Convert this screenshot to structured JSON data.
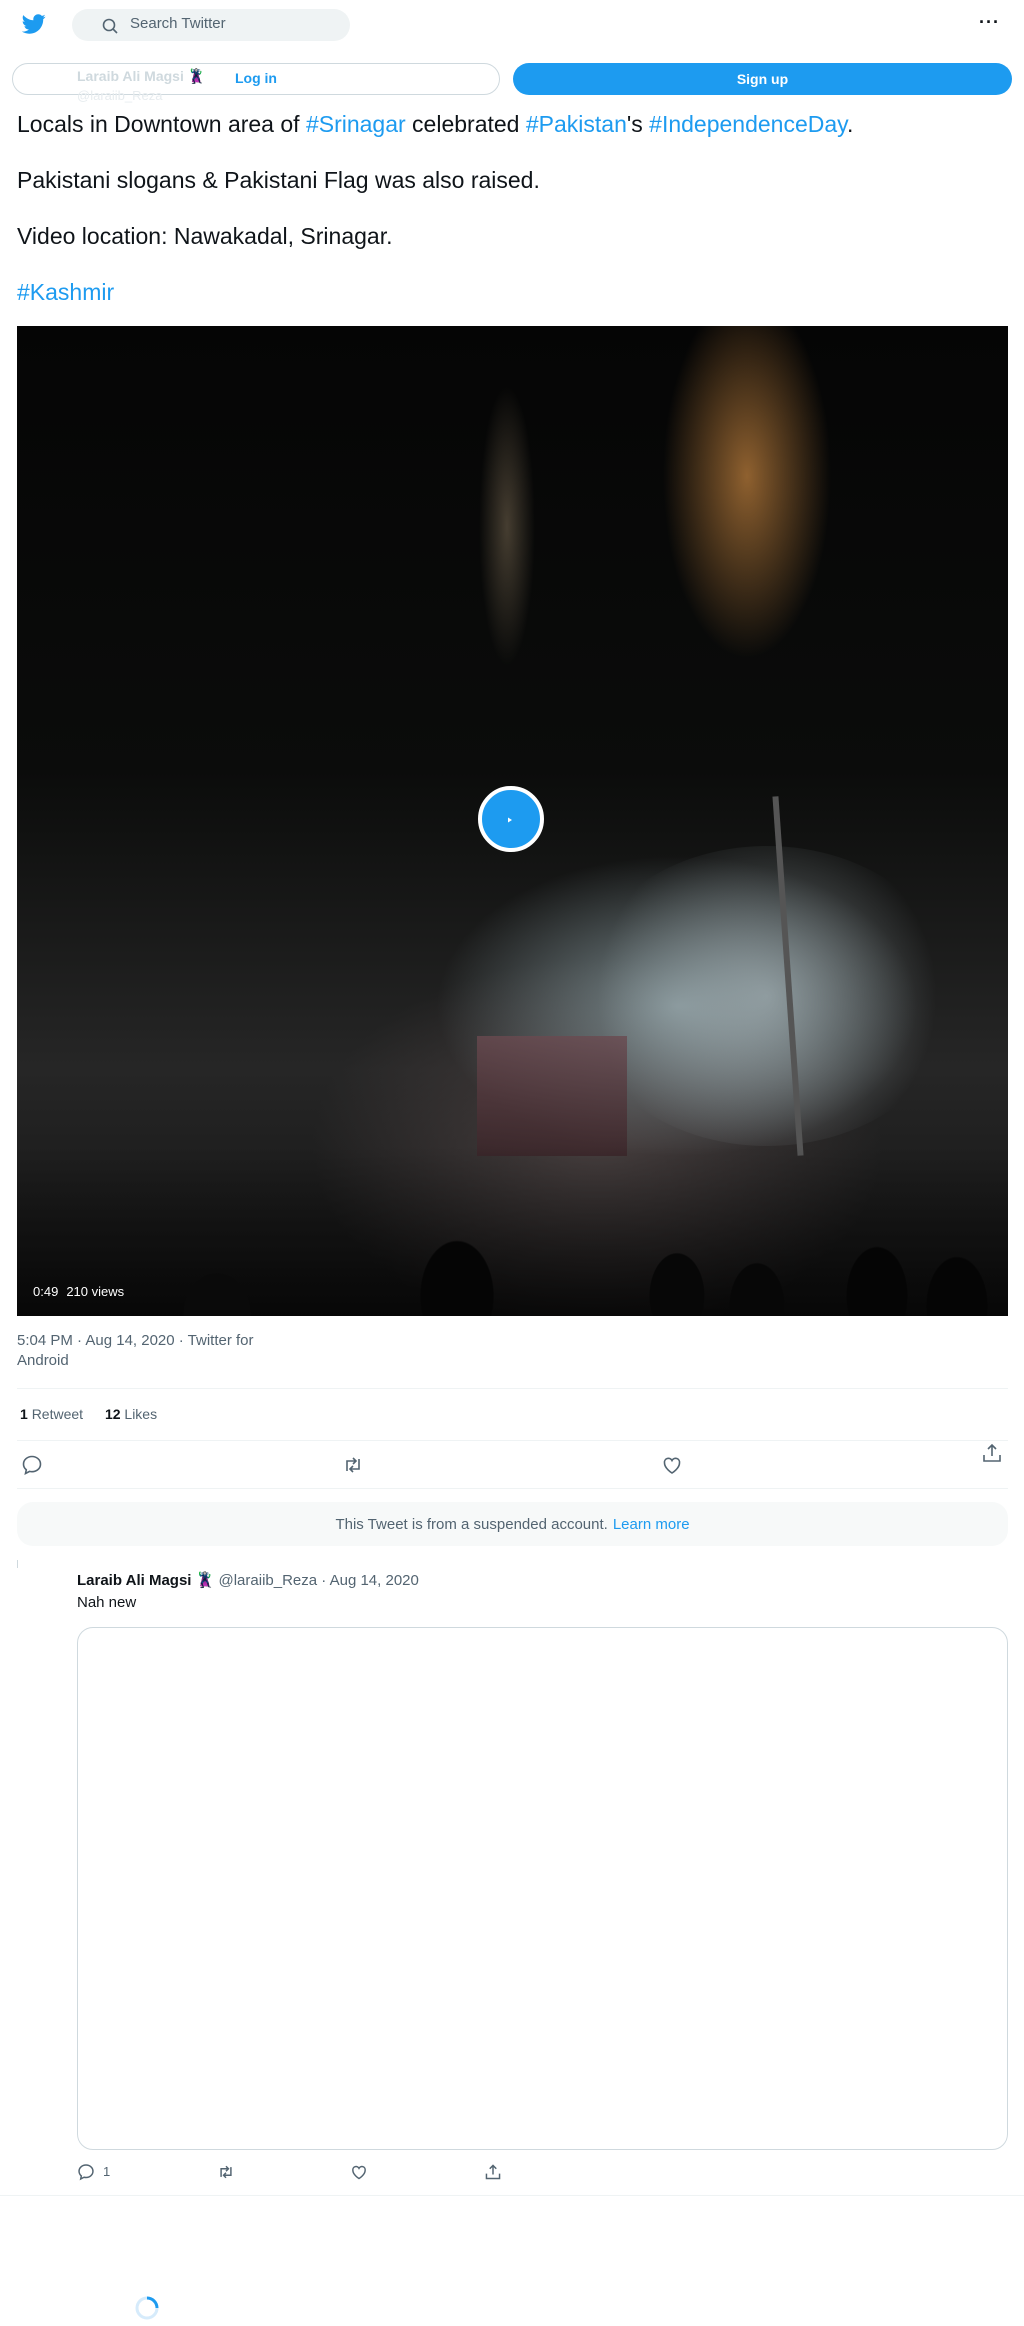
{
  "header": {
    "search_placeholder": "Search Twitter",
    "more_label": "···"
  },
  "login_bar": {
    "user_name": "Laraib Ali Magsi 🦹",
    "user_handle": "@laraiib_Reza",
    "login_label": "Log in",
    "signup_label": "Sign up"
  },
  "tweet": {
    "line1": {
      "t1": "Locals in Downtown area of ",
      "h1": "#Srinagar",
      "t2": " celebrated ",
      "h2": "#Pakistan",
      "t3": "'s ",
      "h3": "#IndependenceDay",
      "t4": "."
    },
    "line2": "Pakistani slogans & Pakistani Flag was also raised.",
    "line3": "Video location: Nawakadal, Srinagar.",
    "line4": "#Kashmir",
    "video": {
      "duration": "0:49",
      "views": "210 views"
    },
    "timestamp": "5:04 PM · Aug 14, 2020 · Twitter for Android",
    "retweets": {
      "count": "1",
      "label": "Retweet"
    },
    "likes": {
      "count": "12",
      "label": "Likes"
    }
  },
  "suspended": {
    "text": "This Tweet is from a suspended account.",
    "link": "Learn more"
  },
  "reply": {
    "name": "Laraib Ali Magsi 🦹",
    "meta": "@laraiib_Reza · Aug 14, 2020",
    "text": "Nah new",
    "reply_count": "1"
  },
  "colors": {
    "accent": "#1d9bf0",
    "text_primary": "#0f1419",
    "text_secondary": "#536471"
  }
}
